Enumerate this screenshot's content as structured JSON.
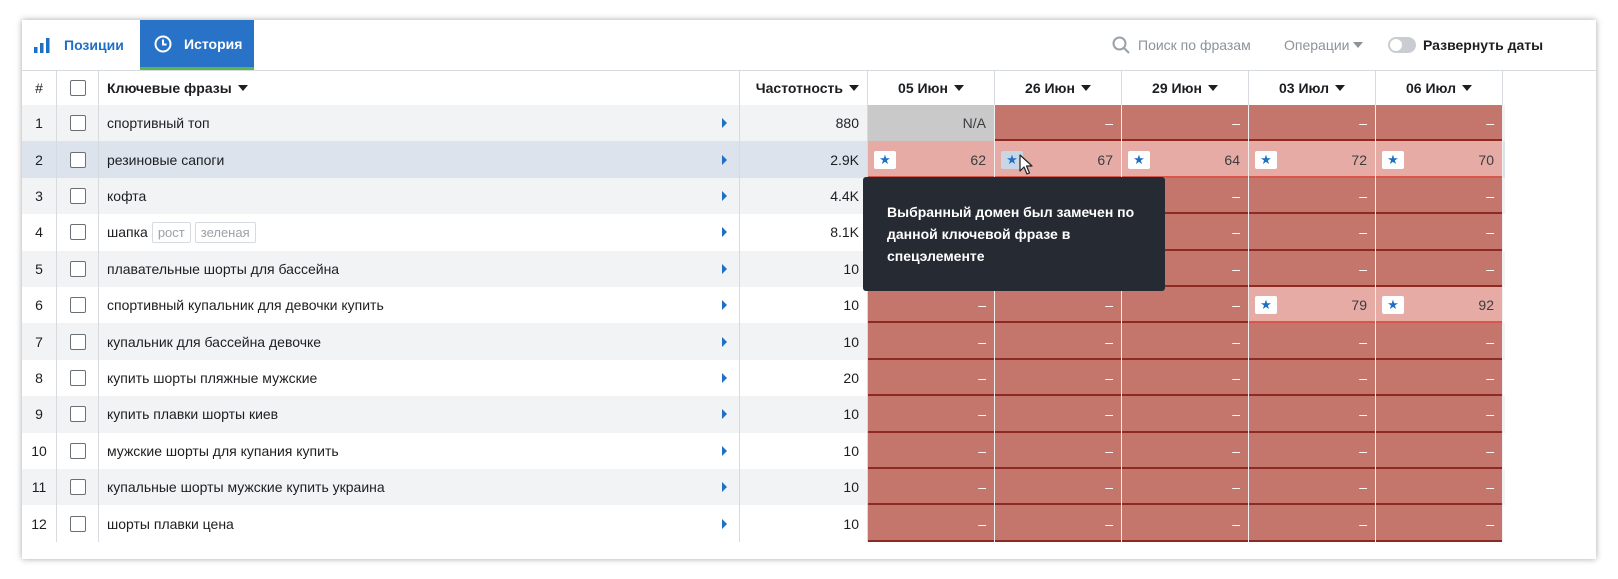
{
  "tabs": [
    {
      "label": "Позиции",
      "active": false,
      "icon": "bar-chart-icon"
    },
    {
      "label": "История",
      "active": true,
      "icon": "clock-icon"
    }
  ],
  "toolbar": {
    "search_placeholder": "Поиск по фразам",
    "operations_label": "Операции",
    "expand_dates_label": "Развернуть даты"
  },
  "table": {
    "headers": {
      "num": "#",
      "keyword": "Ключевые фразы",
      "frequency": "Частотность"
    },
    "dates": [
      "05 Июн",
      "26 Июн",
      "29 Июн",
      "03 Июл",
      "06 Июл"
    ],
    "rows": [
      {
        "num": "1",
        "keyword": "спортивный топ",
        "tags": [],
        "freq": "880",
        "cells": [
          {
            "v": "N/A",
            "t": "na"
          },
          {
            "v": "–",
            "t": "red"
          },
          {
            "v": "–",
            "t": "red"
          },
          {
            "v": "–",
            "t": "red"
          },
          {
            "v": "–",
            "t": "red"
          }
        ]
      },
      {
        "num": "2",
        "keyword": "резиновые сапоги",
        "tags": [],
        "freq": "2.9K",
        "cells": [
          {
            "v": "62",
            "t": "pink",
            "star": true
          },
          {
            "v": "67",
            "t": "pink",
            "star": true
          },
          {
            "v": "64",
            "t": "pink",
            "star": true
          },
          {
            "v": "72",
            "t": "pink",
            "star": true
          },
          {
            "v": "70",
            "t": "pink",
            "star": true
          }
        ]
      },
      {
        "num": "3",
        "keyword": "кофта",
        "tags": [],
        "freq": "4.4K",
        "cells": [
          {
            "v": "–",
            "t": "red"
          },
          {
            "v": "–",
            "t": "red"
          },
          {
            "v": "–",
            "t": "red"
          },
          {
            "v": "–",
            "t": "red"
          },
          {
            "v": "–",
            "t": "red"
          }
        ]
      },
      {
        "num": "4",
        "keyword": "шапка",
        "tags": [
          "рост",
          "зеленая"
        ],
        "freq": "8.1K",
        "cells": [
          {
            "v": "–",
            "t": "red"
          },
          {
            "v": "–",
            "t": "red"
          },
          {
            "v": "–",
            "t": "red"
          },
          {
            "v": "–",
            "t": "red"
          },
          {
            "v": "–",
            "t": "red"
          }
        ]
      },
      {
        "num": "5",
        "keyword": "плавательные шорты для бассейна",
        "tags": [],
        "freq": "10",
        "cells": [
          {
            "v": "–",
            "t": "red"
          },
          {
            "v": "–",
            "t": "red"
          },
          {
            "v": "–",
            "t": "red"
          },
          {
            "v": "–",
            "t": "red"
          },
          {
            "v": "–",
            "t": "red"
          }
        ]
      },
      {
        "num": "6",
        "keyword": "спортивный купальник для девочки купить",
        "tags": [],
        "freq": "10",
        "cells": [
          {
            "v": "–",
            "t": "red"
          },
          {
            "v": "–",
            "t": "red"
          },
          {
            "v": "–",
            "t": "red"
          },
          {
            "v": "79",
            "t": "pink",
            "star": true
          },
          {
            "v": "92",
            "t": "pink",
            "star": true
          }
        ]
      },
      {
        "num": "7",
        "keyword": "купальник для бассейна девочке",
        "tags": [],
        "freq": "10",
        "cells": [
          {
            "v": "–",
            "t": "red"
          },
          {
            "v": "–",
            "t": "red"
          },
          {
            "v": "–",
            "t": "red"
          },
          {
            "v": "–",
            "t": "red"
          },
          {
            "v": "–",
            "t": "red"
          }
        ]
      },
      {
        "num": "8",
        "keyword": "купить шорты пляжные мужские",
        "tags": [],
        "freq": "20",
        "cells": [
          {
            "v": "–",
            "t": "red"
          },
          {
            "v": "–",
            "t": "red"
          },
          {
            "v": "–",
            "t": "red"
          },
          {
            "v": "–",
            "t": "red"
          },
          {
            "v": "–",
            "t": "red"
          }
        ]
      },
      {
        "num": "9",
        "keyword": "купить плавки шорты киев",
        "tags": [],
        "freq": "10",
        "cells": [
          {
            "v": "–",
            "t": "red"
          },
          {
            "v": "–",
            "t": "red"
          },
          {
            "v": "–",
            "t": "red"
          },
          {
            "v": "–",
            "t": "red"
          },
          {
            "v": "–",
            "t": "red"
          }
        ]
      },
      {
        "num": "10",
        "keyword": "мужские шорты для купания купить",
        "tags": [],
        "freq": "10",
        "cells": [
          {
            "v": "–",
            "t": "red"
          },
          {
            "v": "–",
            "t": "red"
          },
          {
            "v": "–",
            "t": "red"
          },
          {
            "v": "–",
            "t": "red"
          },
          {
            "v": "–",
            "t": "red"
          }
        ]
      },
      {
        "num": "11",
        "keyword": "купальные шорты мужские купить украина",
        "tags": [],
        "freq": "10",
        "cells": [
          {
            "v": "–",
            "t": "red"
          },
          {
            "v": "–",
            "t": "red"
          },
          {
            "v": "–",
            "t": "red"
          },
          {
            "v": "–",
            "t": "red"
          },
          {
            "v": "–",
            "t": "red"
          }
        ]
      },
      {
        "num": "12",
        "keyword": "шорты плавки цена",
        "tags": [],
        "freq": "10",
        "cells": [
          {
            "v": "–",
            "t": "red"
          },
          {
            "v": "–",
            "t": "red"
          },
          {
            "v": "–",
            "t": "red"
          },
          {
            "v": "–",
            "t": "red"
          },
          {
            "v": "–",
            "t": "red"
          }
        ]
      }
    ]
  },
  "tooltip": {
    "text": "Выбранный домен был замечен по данной ключевой фразе в спецэлементе"
  },
  "colors": {
    "accent": "#2872c8",
    "not_found": "#c4766c",
    "found": "#e5aba4",
    "na": "#c9c9c9",
    "tooltip_bg": "#262a33"
  }
}
